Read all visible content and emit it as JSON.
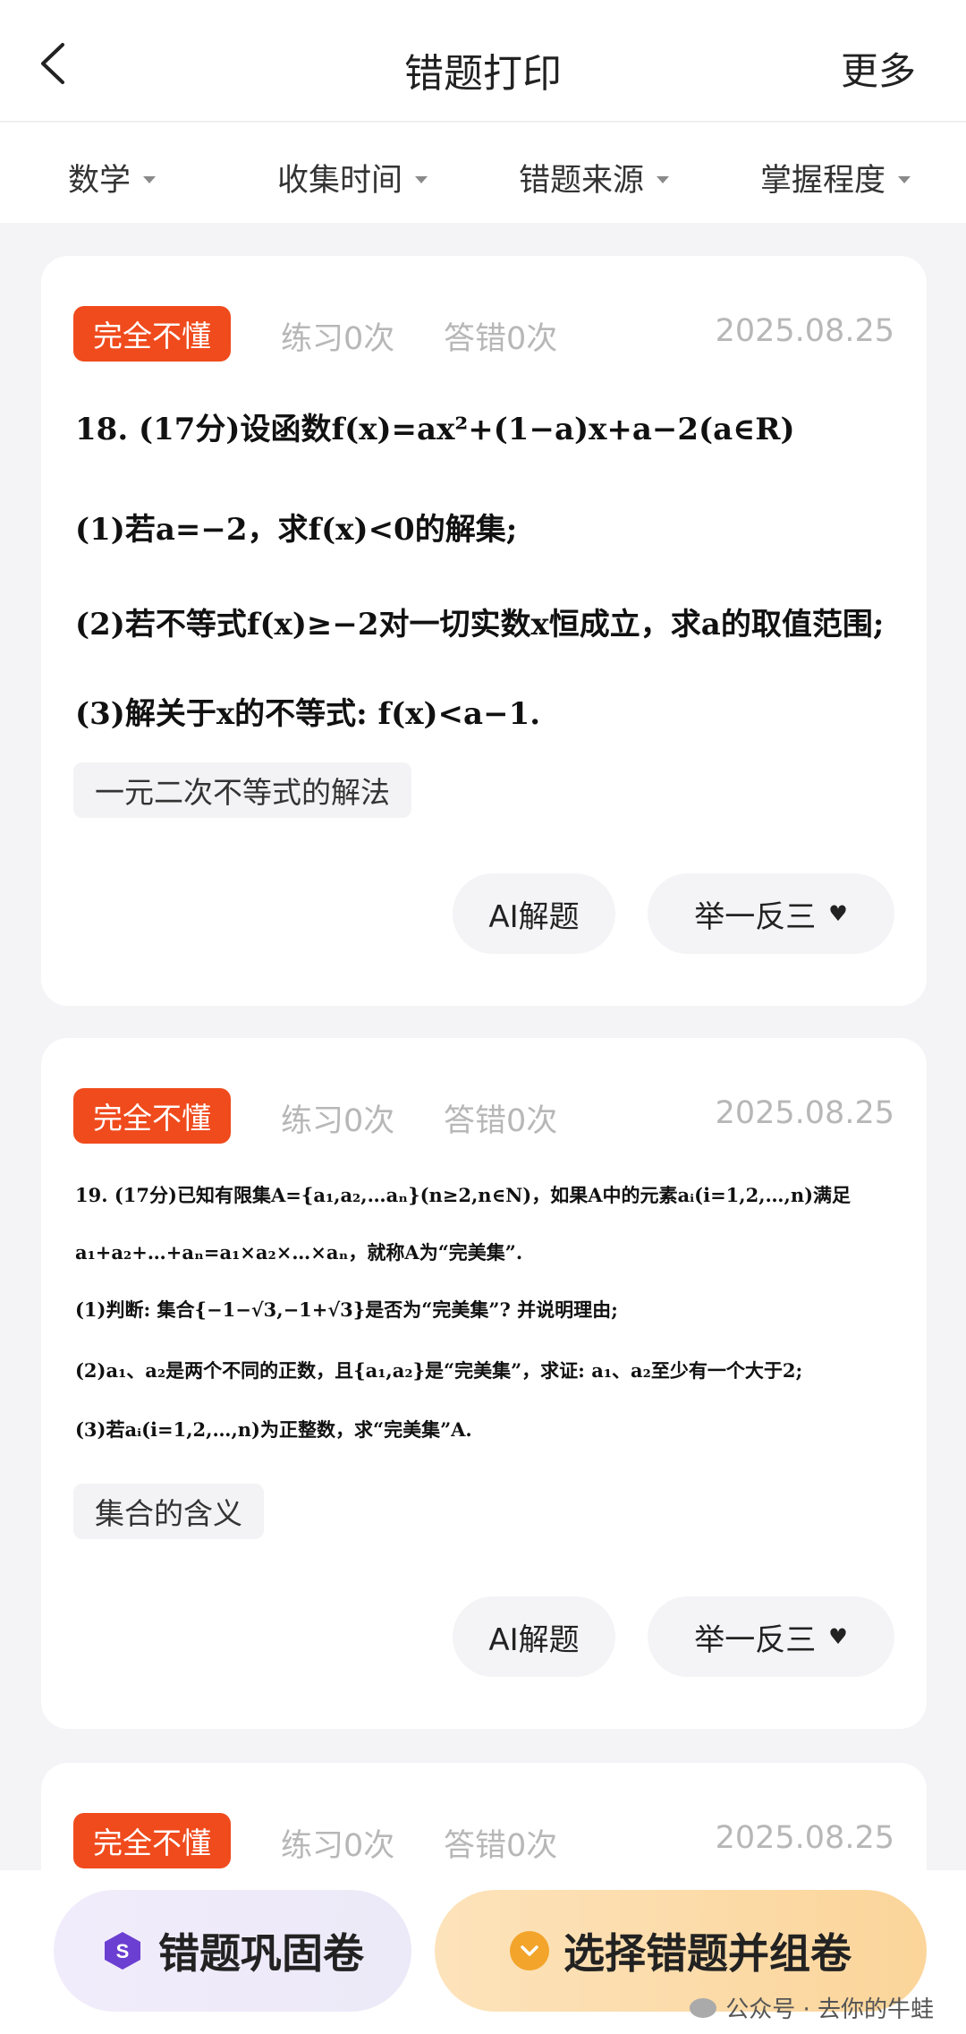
{
  "header": {
    "title": "错题打印",
    "more_label": "更多"
  },
  "filters": [
    {
      "label": "数学"
    },
    {
      "label": "收集时间"
    },
    {
      "label": "错题来源"
    },
    {
      "label": "掌握程度"
    }
  ],
  "cards": [
    {
      "badge": "完全不懂",
      "practice": "练习0次",
      "wrong": "答错0次",
      "date": "2025.08.25",
      "question_lines": [
        "18. (17分)设函数f(x)=ax²+(1−a)x+a−2(a∈R)",
        "(1)若a=−2，求f(x)<0的解集;",
        "(2)若不等式f(x)≥−2对一切实数x恒成立，求a的取值范围;",
        "(3)解关于x的不等式: f(x)<a−1."
      ],
      "tag": "一元二次不等式的解法",
      "ai_label": "AI解题",
      "similar_label": "举一反三"
    },
    {
      "badge": "完全不懂",
      "practice": "练习0次",
      "wrong": "答错0次",
      "date": "2025.08.25",
      "question_lines": [
        "19. (17分)已知有限集A={a₁,a₂,…aₙ}(n≥2,n∈N)，如果A中的元素aᵢ(i=1,2,…,n)满足",
        "a₁+a₂+…+aₙ=a₁×a₂×…×aₙ，就称A为“完美集”.",
        "(1)判断: 集合{−1−√3,−1+√3}是否为“完美集”? 并说明理由;",
        "(2)a₁、a₂是两个不同的正数，且{a₁,a₂}是“完美集”，求证: a₁、a₂至少有一个大于2;",
        "(3)若aᵢ(i=1,2,…,n)为正整数，求“完美集”A."
      ],
      "tag": "集合的含义",
      "ai_label": "AI解题",
      "similar_label": "举一反三"
    },
    {
      "badge": "完全不懂",
      "practice": "练习0次",
      "wrong": "答错0次",
      "date": "2025.08.25"
    }
  ],
  "bottom": {
    "consolidate_label": "错题巩固卷",
    "select_label": "选择错题并组卷"
  },
  "watermark": "公众号 · 去你的牛蛙",
  "colors": {
    "badge": "#f04b1d",
    "accent_orange": "#fbd59a",
    "accent_purple": "#6b3fd1"
  }
}
